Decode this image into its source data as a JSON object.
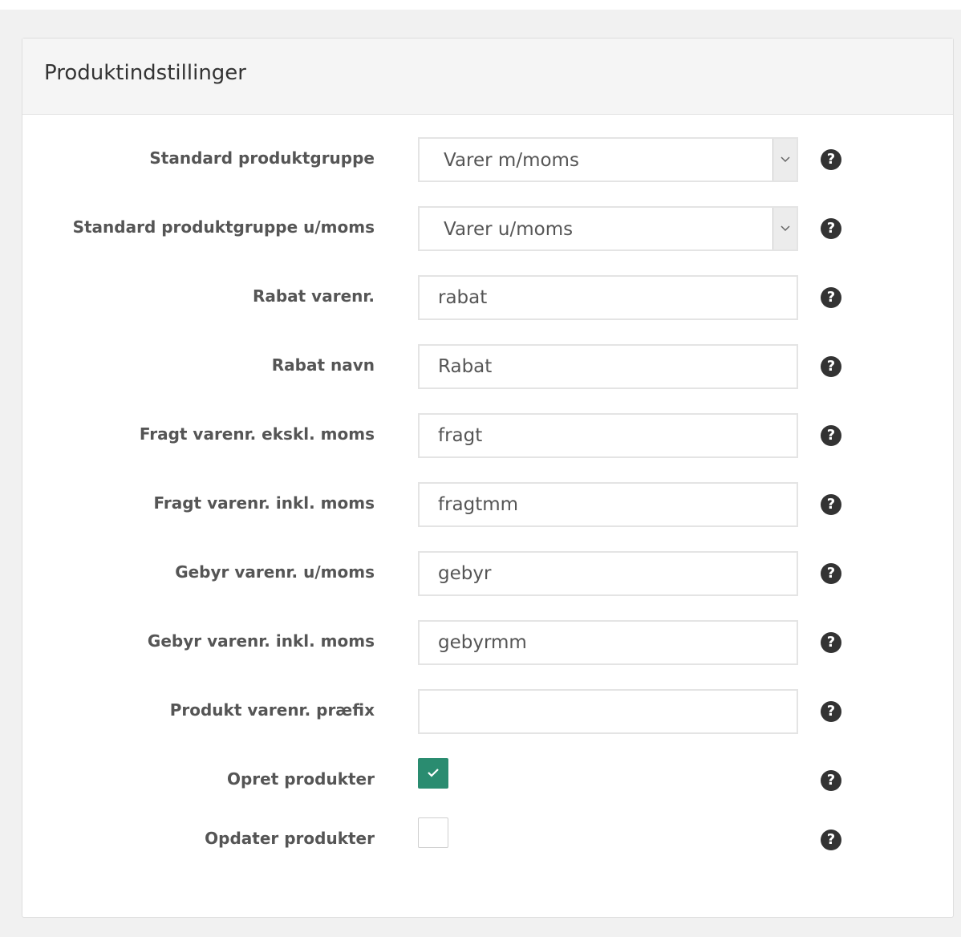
{
  "panel": {
    "title": "Produktindstillinger"
  },
  "help_icon_glyph": "?",
  "form": {
    "rows": [
      {
        "label": "Standard produktgruppe",
        "type": "select",
        "value": "Varer m/moms"
      },
      {
        "label": "Standard produktgruppe u/moms",
        "type": "select",
        "value": "Varer u/moms"
      },
      {
        "label": "Rabat varenr.",
        "type": "text",
        "value": "rabat"
      },
      {
        "label": "Rabat navn",
        "type": "text",
        "value": "Rabat"
      },
      {
        "label": "Fragt varenr. ekskl. moms",
        "type": "text",
        "value": "fragt"
      },
      {
        "label": "Fragt varenr. inkl. moms",
        "type": "text",
        "value": "fragtmm"
      },
      {
        "label": "Gebyr varenr. u/moms",
        "type": "text",
        "value": "gebyr"
      },
      {
        "label": "Gebyr varenr. inkl. moms",
        "type": "text",
        "value": "gebyrmm"
      },
      {
        "label": "Produkt varenr. præfix",
        "type": "text",
        "value": ""
      },
      {
        "label": "Opret produkter",
        "type": "checkbox",
        "checked": true
      },
      {
        "label": "Opdater produkter",
        "type": "checkbox",
        "checked": false
      }
    ]
  },
  "colors": {
    "checkbox_checked": "#2a8c70",
    "help_icon": "#333333",
    "label_text": "#555555"
  }
}
